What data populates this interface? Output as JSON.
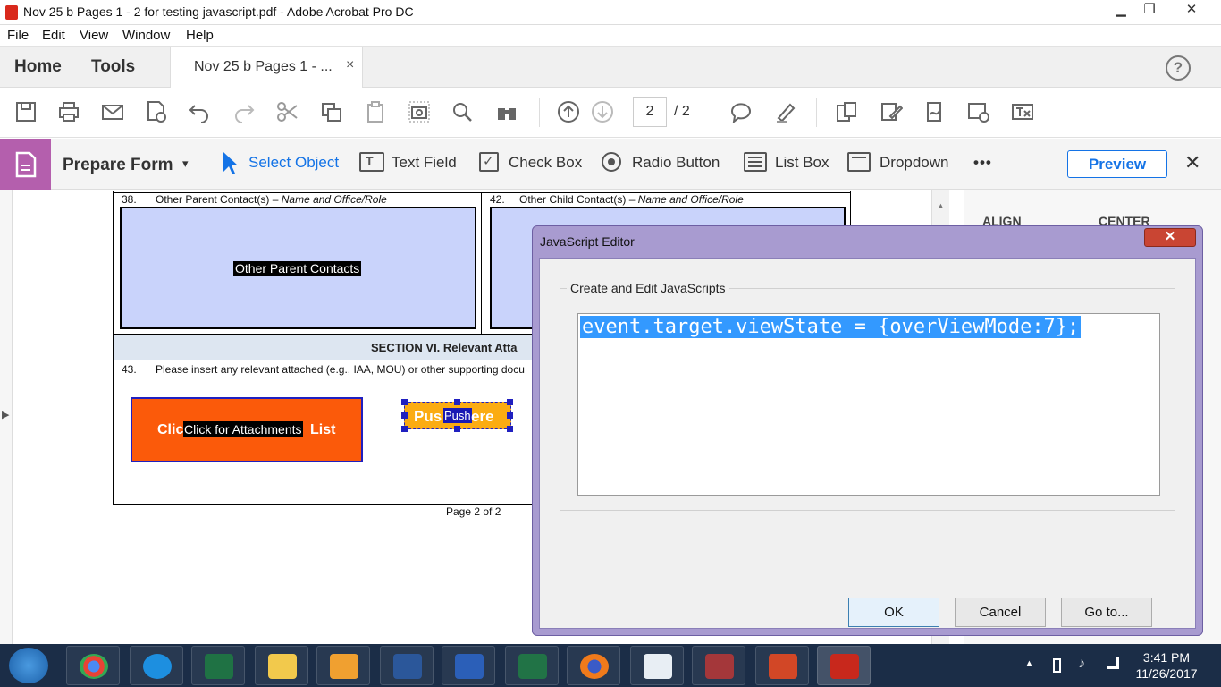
{
  "window": {
    "title": "Nov 25 b Pages 1 - 2 for testing javascript.pdf - Adobe Acrobat Pro DC",
    "minimize": "▁",
    "maximize": "❐",
    "close": "✕"
  },
  "menu": [
    "File",
    "Edit",
    "View",
    "Window",
    "Help"
  ],
  "tabs": {
    "home": "Home",
    "tools": "Tools",
    "document": "Nov 25 b Pages 1 - ...",
    "close": "×",
    "help": "?"
  },
  "toolbar": {
    "current_page": "2",
    "total_pages": "/ 2"
  },
  "formbar": {
    "title": "Prepare Form",
    "caret": "▾",
    "select_object": "Select Object",
    "text_field": "Text Field",
    "check_box": "Check Box",
    "radio_button": "Radio Button",
    "list_box": "List Box",
    "dropdown": "Dropdown",
    "more": "•••",
    "preview": "Preview",
    "close": "✕"
  },
  "document": {
    "field38_number": "38.",
    "field38_label": "Other Parent Contact(s) – ",
    "field38_italic": "Name and Office/Role",
    "field42_number": "42.",
    "field42_label": "Other Child Contact(s) – ",
    "field42_italic": "Name and Office/Role",
    "parent_field_name": "Other Parent Contacts",
    "section_heading": "SECTION VI.  Relevant Atta",
    "field43_number": "43.",
    "field43_label": "Please insert any relevant attached (e.g., IAA, MOU) or other supporting docu",
    "attach_button_prefix": "Clic",
    "attach_button_name": "Click for Attachments",
    "attach_button_suffix": "List",
    "push_button_prefix": "Pus",
    "push_button_name": "Push",
    "push_button_suffix": "ere",
    "page_footer": "Page 2 of 2"
  },
  "right_panel": {
    "align": "ALIGN",
    "center": "CENTER"
  },
  "dialog": {
    "title": "JavaScript Editor",
    "close": "✕",
    "group_label": "Create and Edit JavaScripts",
    "code": "event.target.viewState = {overViewMode:7};",
    "ok": "OK",
    "cancel": "Cancel",
    "goto": "Go to..."
  },
  "taskbar": {
    "apps": [
      "start-orb",
      "chrome",
      "internet-explorer",
      "excel",
      "file-explorer",
      "outlook",
      "visio",
      "word",
      "project",
      "firefox",
      "publisher",
      "access",
      "powerpoint",
      "acrobat"
    ],
    "time": "3:41 PM",
    "date": "11/26/2017"
  },
  "colors": {
    "form_accent": "#b45fad",
    "preview_blue": "#1473e6",
    "field_fill": "#c9d3fb",
    "attach_button": "#fb5a0a",
    "push_button": "#fbac12",
    "selection": "#3399ff"
  }
}
